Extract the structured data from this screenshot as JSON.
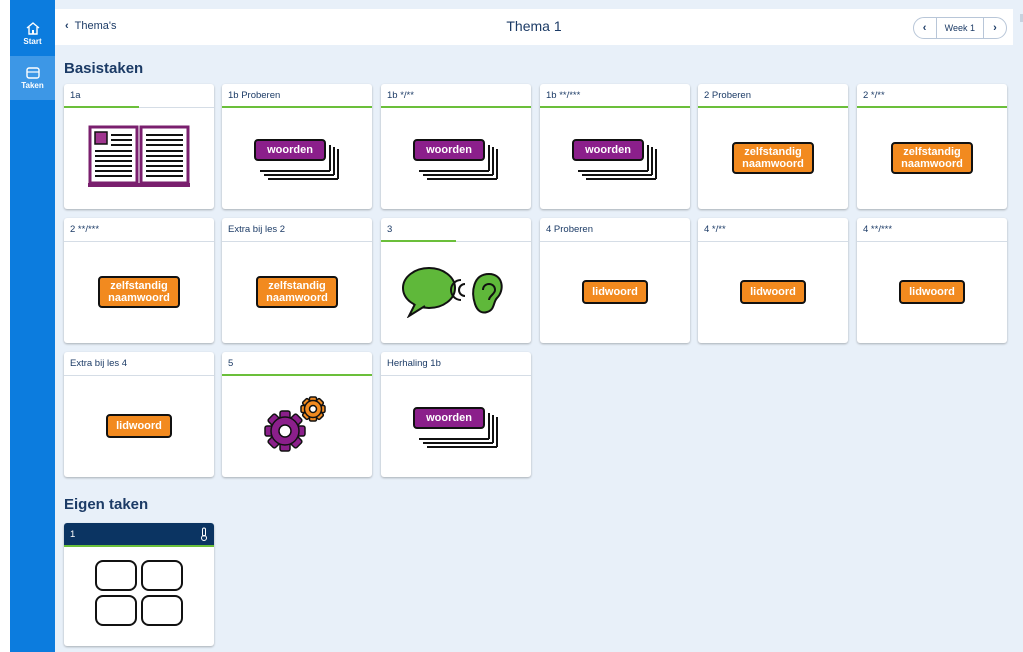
{
  "sidebar": {
    "items": [
      {
        "label": "Start",
        "icon": "home-icon"
      },
      {
        "label": "Taken",
        "icon": "tasks-icon",
        "active": true
      }
    ]
  },
  "header": {
    "back_label": "Thema's",
    "title": "Thema 1",
    "week_label": "Week 1"
  },
  "sections": {
    "basis_title": "Basistaken",
    "eigen_title": "Eigen taken"
  },
  "cards": [
    {
      "title": "1a",
      "illustration": "book",
      "progress": 0.5
    },
    {
      "title": "1b Proberen",
      "illustration": "woorden",
      "progress": 1
    },
    {
      "title": "1b */**",
      "illustration": "woorden",
      "progress": 1
    },
    {
      "title": "1b **/***",
      "illustration": "woorden",
      "progress": 1
    },
    {
      "title": "2 Proberen",
      "illustration": "zelfstandig",
      "progress": 1
    },
    {
      "title": "2 */**",
      "illustration": "zelfstandig",
      "progress": 1
    },
    {
      "title": "2 **/***",
      "illustration": "zelfstandig",
      "progress": 0
    },
    {
      "title": "Extra bij les 2",
      "illustration": "zelfstandig",
      "progress": 0
    },
    {
      "title": "3",
      "illustration": "speak-listen",
      "progress": 0.5
    },
    {
      "title": "4 Proberen",
      "illustration": "lidwoord",
      "progress": 0
    },
    {
      "title": "4 */**",
      "illustration": "lidwoord",
      "progress": 0
    },
    {
      "title": "4 **/***",
      "illustration": "lidwoord",
      "progress": 0
    },
    {
      "title": "Extra bij les 4",
      "illustration": "lidwoord",
      "progress": 0
    },
    {
      "title": "5",
      "illustration": "gears",
      "progress": 1
    },
    {
      "title": "Herhaling 1b",
      "illustration": "woorden",
      "progress": 0
    }
  ],
  "labels": {
    "woorden": "woorden",
    "zelfstandig_line1": "zelfstandig",
    "zelfstandig_line2": "naamwoord",
    "lidwoord": "lidwoord"
  },
  "own_tasks": [
    {
      "title": "1",
      "icon": "thermometer-icon",
      "illustration": "grid"
    }
  ],
  "colors": {
    "rail": "#0c7cde",
    "background": "#e8f0f9",
    "purple_tag": "#8b1f8b",
    "orange_tag": "#f28a1f",
    "progress": "#6bbf3a",
    "own_header": "#0b3462"
  }
}
